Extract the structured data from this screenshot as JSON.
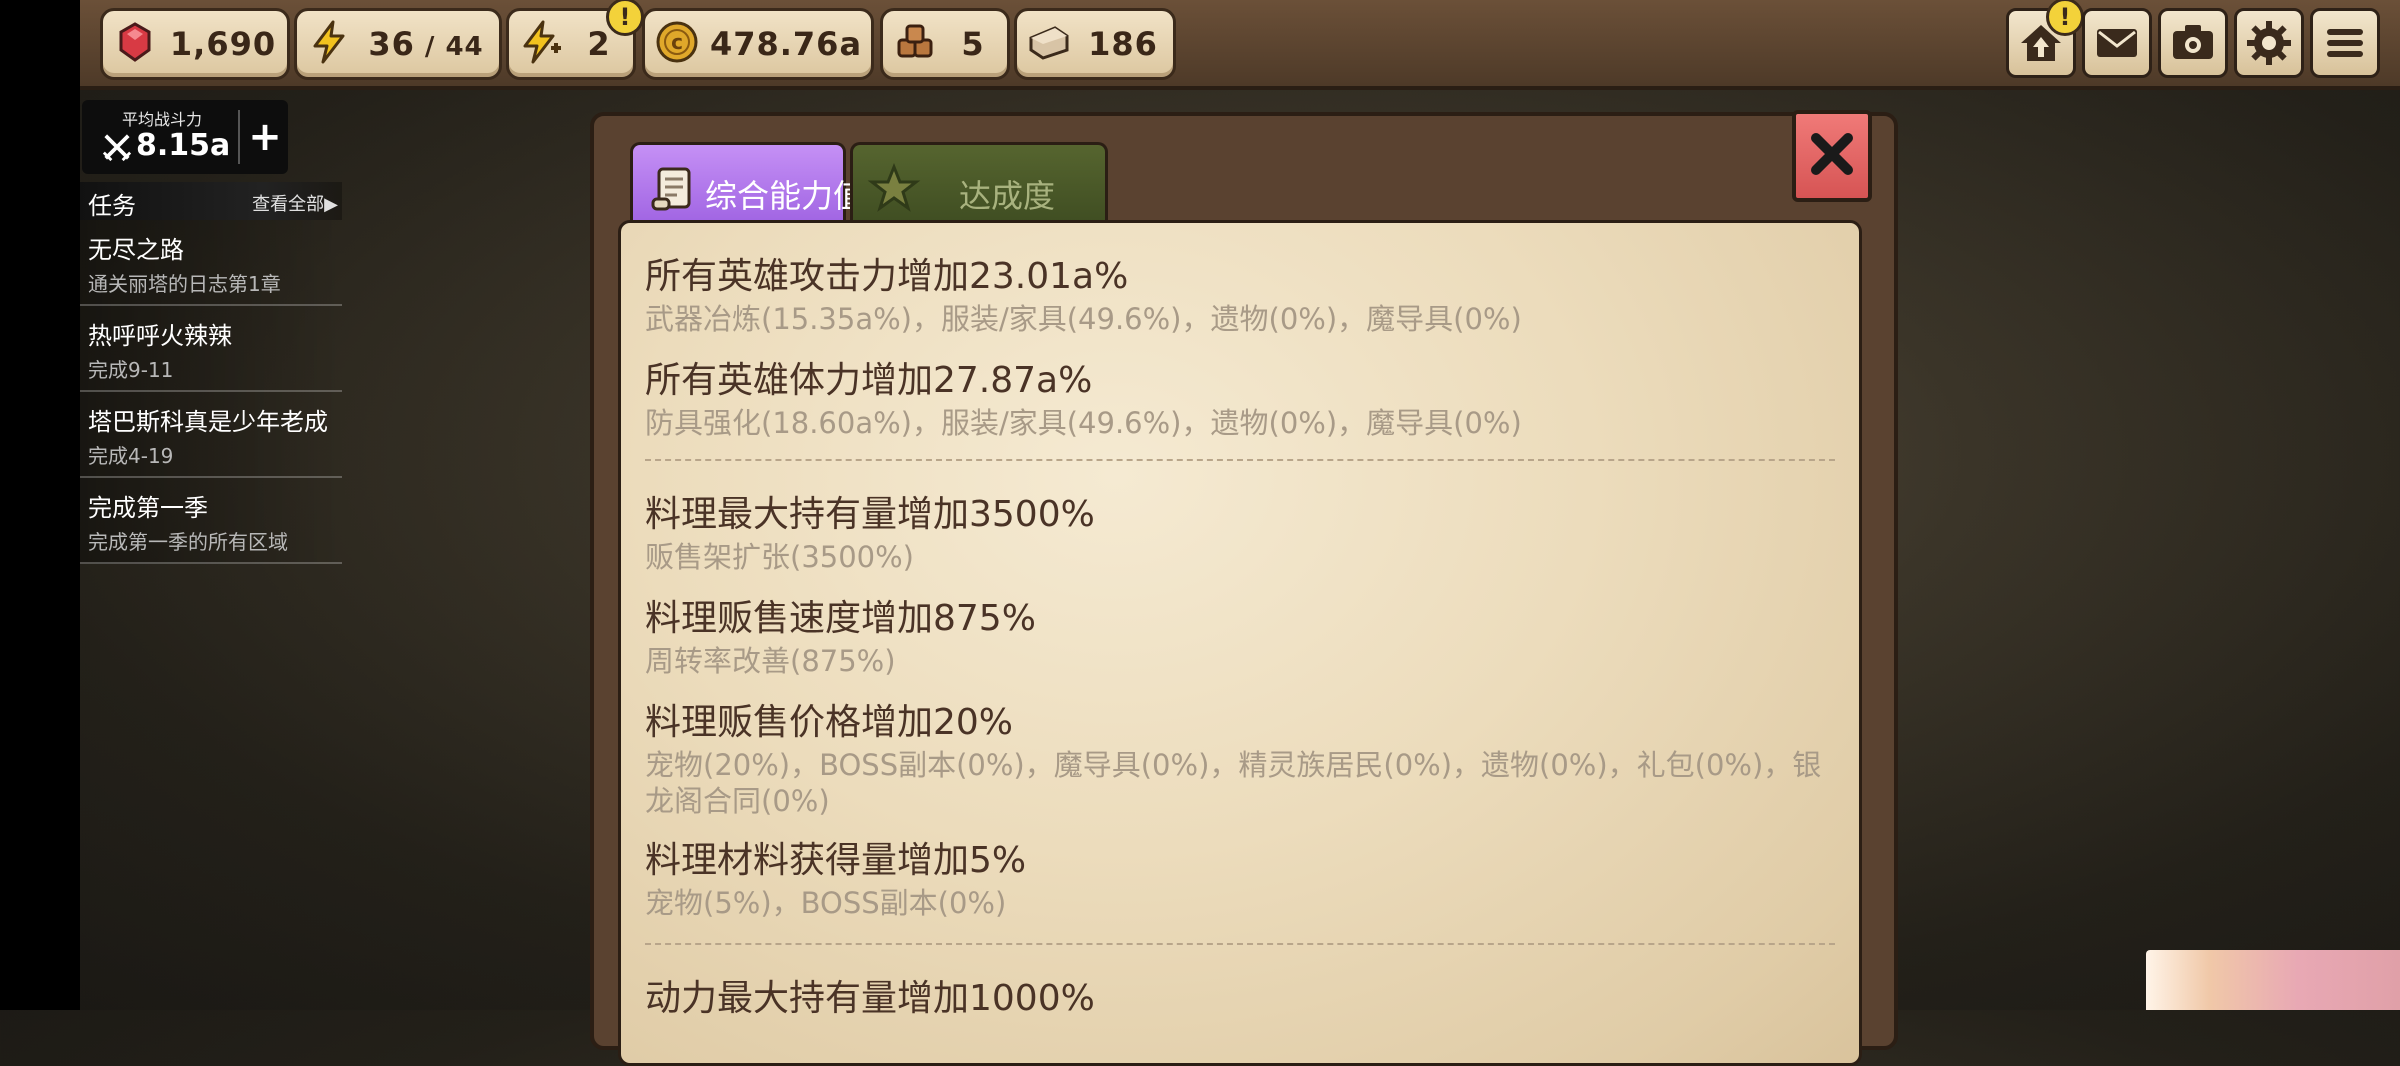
{
  "resources": {
    "gems": "1,690",
    "energy_current": "36",
    "energy_sep": " / ",
    "energy_max": "44",
    "boost": "2",
    "boost_badge": "!",
    "gold": "478.76a",
    "wood": "5",
    "stone": "186"
  },
  "top_buttons": {
    "home_badge": "!",
    "icons": [
      "home-upgrade-icon",
      "mail-icon",
      "camera-icon",
      "settings-gear-icon",
      "menu-icon"
    ]
  },
  "power": {
    "label": "平均战斗力",
    "value": "8.15a",
    "plus": "+"
  },
  "quests": {
    "title": "任务",
    "view_all": "查看全部▶",
    "items": [
      {
        "name": "无尽之路",
        "desc": "通关丽塔的日志第1章"
      },
      {
        "name": "热呼呼火辣辣",
        "desc": "完成9-11"
      },
      {
        "name": "塔巴斯科真是少年老成",
        "desc": "完成4-19"
      },
      {
        "name": "完成第一季",
        "desc": "完成第一季的所有区域"
      }
    ]
  },
  "dialog": {
    "tabs": [
      {
        "label": "综合能力值",
        "active": true
      },
      {
        "label": "达成度",
        "active": false
      }
    ],
    "stats": [
      {
        "title": "所有英雄攻击力增加23.01a%",
        "detail": "武器冶炼(15.35a%)，服装/家具(49.6%)，遗物(0%)，魔导具(0%)"
      },
      {
        "title": "所有英雄体力增加27.87a%",
        "detail": "防具强化(18.60a%)，服装/家具(49.6%)，遗物(0%)，魔导具(0%)"
      },
      {
        "title": "料理最大持有量增加3500%",
        "detail": "贩售架扩张(3500%)"
      },
      {
        "title": "料理贩售速度增加875%",
        "detail": "周转率改善(875%)"
      },
      {
        "title": "料理贩售价格增加20%",
        "detail": "宠物(20%)，BOSS副本(0%)，魔导具(0%)，精灵族居民(0%)，遗物(0%)，礼包(0%)，银龙阁合同(0%)"
      },
      {
        "title": "料理材料获得量增加5%",
        "detail": "宠物(5%)，BOSS副本(0%)"
      },
      {
        "title": "动力最大持有量增加1000%",
        "detail": ""
      }
    ]
  },
  "colors": {
    "gem": "#d83a44",
    "energy": "#f2c21e",
    "gold": "#e0a82a",
    "tab_active": "#b07ae8",
    "tab_inactive": "#4a5a28",
    "close": "#e06464",
    "parchment": "#f0e2c6"
  }
}
